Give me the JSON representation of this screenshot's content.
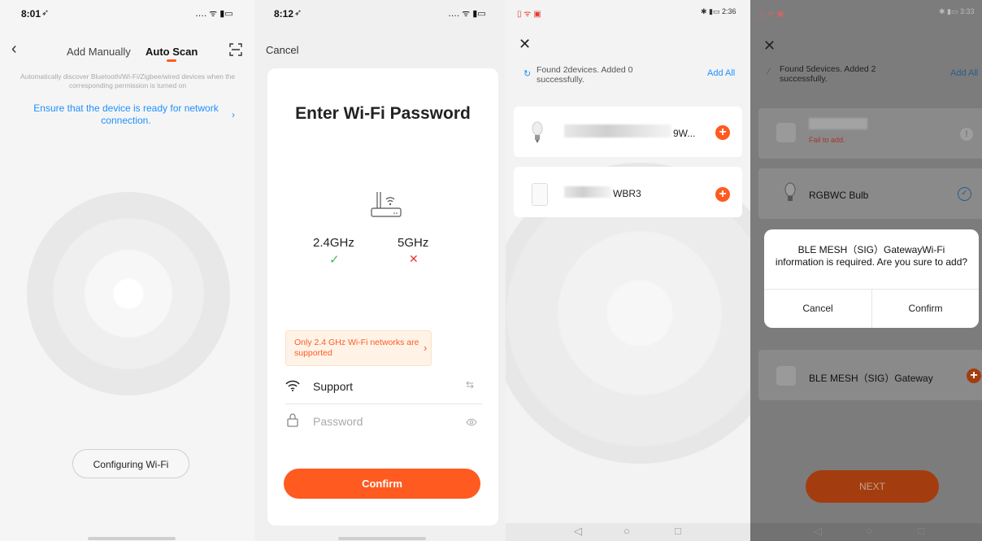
{
  "screen1": {
    "time": "8:01",
    "tab_manual": "Add Manually",
    "tab_auto": "Auto Scan",
    "description": "Automatically discover Bluetooth/Wi-Fi/Zigbee/wired devices when the corresponding permission is turned on",
    "ensure_link": "Ensure that the device is ready for network connection.",
    "configuring_button": "Configuring Wi-Fi",
    "accent": "#1e90ff",
    "tab_indicator_color": "#ff5a1f"
  },
  "screen2": {
    "time": "8:12",
    "cancel": "Cancel",
    "title": "Enter Wi-Fi Password",
    "band_24": "2.4GHz",
    "band_5": "5GHz",
    "band_24_status": "✓",
    "band_5_status": "✕",
    "warning": "Only 2.4 GHz Wi-Fi networks are supported",
    "ssid_value": "Support",
    "password_placeholder": "Password",
    "confirm_button": "Confirm",
    "brand_orange": "#ff5a1f"
  },
  "screen3": {
    "time": "2:36",
    "found_text": "Found 2devices. Added 0 successfully.",
    "add_all": "Add All",
    "devices": [
      {
        "name_suffix": "9W..."
      },
      {
        "name_suffix": "WBR3"
      }
    ]
  },
  "screen4": {
    "time": "3:33",
    "found_text": "Found 5devices. Added 2 successfully.",
    "add_all": "Add All",
    "fail_text": "Fail to add.",
    "device_bulb": "RGBWC Bulb",
    "device_gateway": "BLE MESH（SIG）Gateway",
    "dialog_message": "BLE MESH（SIG）GatewayWi-Fi information is required. Are you sure to add?",
    "dialog_cancel": "Cancel",
    "dialog_confirm": "Confirm",
    "next_button": "NEXT"
  }
}
